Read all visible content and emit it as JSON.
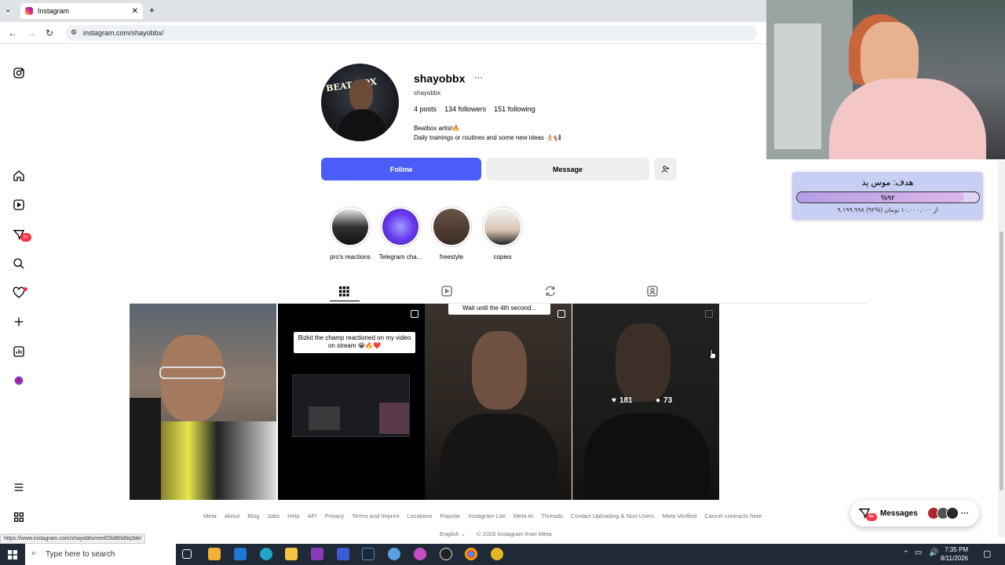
{
  "browser": {
    "tab_title": "Instagram",
    "url": "instagram.com/shayobbx/",
    "status_url": "https://www.instagram.com/shayobbx/reel/DbiB0d6q3de/"
  },
  "sidebar": {
    "icons": [
      "instagram-logo-icon",
      "home-icon",
      "reels-icon",
      "messages-icon",
      "search-icon",
      "notifications-icon",
      "create-icon",
      "insights-icon",
      "profile-icon",
      "menu-icon",
      "apps-icon"
    ],
    "messages_badge": "9+"
  },
  "profile": {
    "username": "shayobbx",
    "more": "···",
    "handle": "shayobbx",
    "posts": "4",
    "posts_label": "posts",
    "followers": "134",
    "followers_label": "followers",
    "following": "151",
    "following_label": "following",
    "bio_line1": "Beatbox artist🔥",
    "bio_line2": "Daily trainings or routines and some new ideas 👌🏼📢",
    "avatar_text": "BEAT BOX"
  },
  "actions": {
    "follow": "Follow",
    "message": "Message"
  },
  "highlights": [
    {
      "label": "pro's reactions"
    },
    {
      "label": "Telegram cha..."
    },
    {
      "label": "freestyle"
    },
    {
      "label": "copies"
    }
  ],
  "posts": {
    "p2_caption": "Bizkit the champ reactioned on my video on stream 😭🔥❤️",
    "p3_caption": "Wait until the 4th second...",
    "p4_likes": "181",
    "p4_comments": "73"
  },
  "footer": {
    "links": [
      "Meta",
      "About",
      "Blog",
      "Jobs",
      "Help",
      "API",
      "Privacy",
      "Terms and Imprint",
      "Locations",
      "Popular",
      "Instagram Lite",
      "Meta AI",
      "Threads",
      "Contact Uploading & Non-Users",
      "Meta Verified",
      "Cancel contracts here"
    ],
    "language": "English ⌄",
    "copyright": "© 2026 Instagram from Meta"
  },
  "messages_pill": {
    "label": "Messages",
    "badge": "9+"
  },
  "donation": {
    "title": "هدف: موس پد",
    "percent_text": "%۹۲",
    "progress": 0.92,
    "amount_text": "۹,۱۹۹,۹۹۸ از ۱۰,۰۰۰,۰۰۰ تومان (%۹۲)"
  },
  "taskbar": {
    "search_placeholder": "Type here to search",
    "time": "7:35 PM",
    "date": "8/11/2026"
  }
}
